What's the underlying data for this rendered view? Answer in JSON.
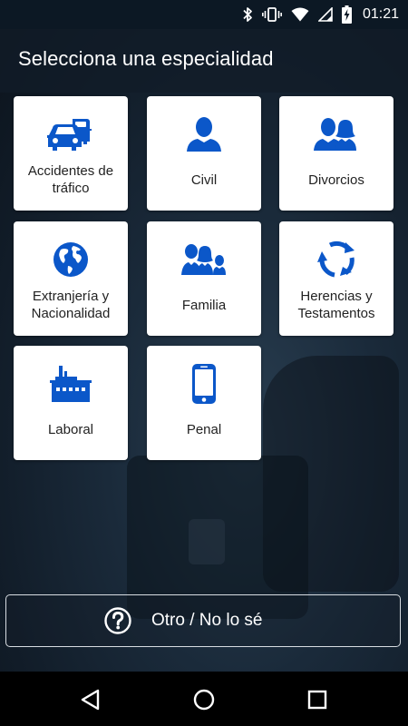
{
  "status_bar": {
    "time": "01:21",
    "icons": [
      "bluetooth-icon",
      "vibrate-icon",
      "wifi-icon",
      "signal-icon",
      "battery-charging-icon"
    ]
  },
  "header": {
    "title": "Selecciona una especialidad"
  },
  "specialties": [
    {
      "label": "Accidentes de tráfico",
      "icon": "cars-icon"
    },
    {
      "label": "Civil",
      "icon": "person-icon"
    },
    {
      "label": "Divorcios",
      "icon": "couple-icon"
    },
    {
      "label": "Extranjería y Nacionalidad",
      "icon": "globe-icon"
    },
    {
      "label": "Familia",
      "icon": "family-icon"
    },
    {
      "label": "Herencias y Testamentos",
      "icon": "cycle-arrows-icon"
    },
    {
      "label": "Laboral",
      "icon": "factory-icon"
    },
    {
      "label": "Penal",
      "icon": "mobile-phone-icon"
    }
  ],
  "other_option": {
    "label": "Otro / No lo sé",
    "icon": "question-circle-icon"
  },
  "nav": {
    "icons": [
      "back-icon",
      "home-icon",
      "recents-icon"
    ]
  },
  "colors": {
    "accent_blue": "#0b57c9",
    "status_bar": "#0c1824",
    "tile_bg": "#ffffff"
  }
}
